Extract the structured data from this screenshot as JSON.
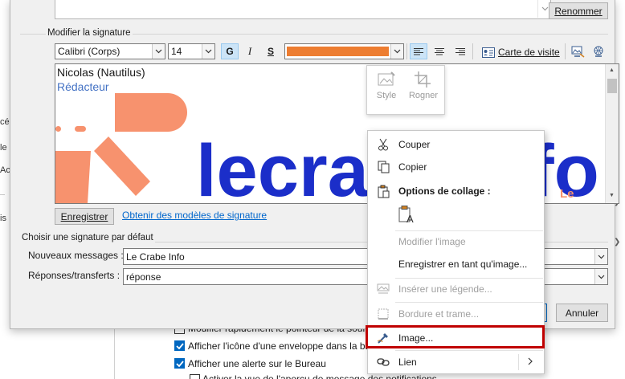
{
  "background": {
    "left_edge_texts": [
      "cé",
      "le",
      "Ac",
      "is"
    ],
    "checkboxes": [
      {
        "label": "Modifier rapidement le pointeur de la souris",
        "checked": false
      },
      {
        "label": "Afficher l'icône d'une enveloppe dans la barre",
        "checked": true
      },
      {
        "label": "Afficher une alerte sur le Bureau",
        "checked": true
      }
    ],
    "third_row_text": "Activer la vue de l'aperçu de message des notifications"
  },
  "dialog": {
    "rename_button": "Renommer",
    "edit_group_label": "Modifier la signature",
    "toolbar": {
      "font_name": "Calibri (Corps)",
      "font_size": "14",
      "bold": "G",
      "italic": "I",
      "underline": "S",
      "font_color": "#ed7d31",
      "business_card_label": "Carte de visite"
    },
    "signature": {
      "name_line": "Nicolas (Nautilus)",
      "title_line": "Rédacteur",
      "title_color": "#4472c4",
      "logo_text": "lecrab",
      "logo_tail": "fo",
      "logo_small": "Le",
      "logo_color": "#1b2ec9",
      "logo_accent": "#f7926e"
    },
    "save_button": "Enregistrer",
    "templates_link": "Obtenir des modèles de signature",
    "default_group_label": "Choisir une signature par défaut",
    "new_messages_label": "Nouveaux messages :",
    "new_messages_value": "Le Crabe Info",
    "replies_label": "Réponses/transferts :",
    "replies_value": "réponse",
    "cancel_button": "Annuler"
  },
  "mini_toolbar": {
    "style_label": "Style",
    "crop_label": "Rogner"
  },
  "context_menu": {
    "items": [
      {
        "label": "Couper",
        "disabled": false
      },
      {
        "label": "Copier",
        "disabled": false
      },
      {
        "label": "Options de collage :",
        "disabled": false
      },
      {
        "label": "Modifier l'image",
        "disabled": true
      },
      {
        "label": "Enregistrer en tant qu'image...",
        "disabled": false
      },
      {
        "label": "Insérer une légende...",
        "disabled": true
      },
      {
        "label": "Bordure et trame...",
        "disabled": true
      },
      {
        "label": "Image...",
        "disabled": false
      },
      {
        "label": "Lien",
        "disabled": false
      }
    ],
    "highlight_color": "#c00000"
  }
}
